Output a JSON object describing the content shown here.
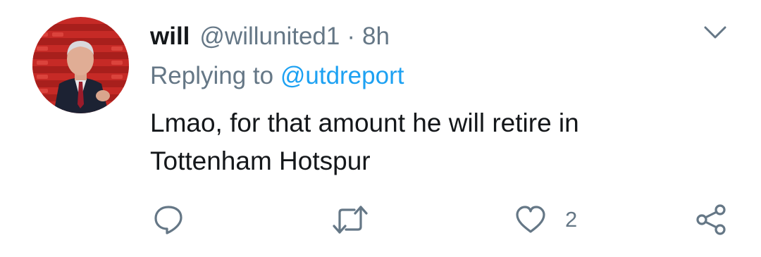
{
  "tweet": {
    "display_name": "will",
    "handle": "@willunited1",
    "separator": "·",
    "time": "8h",
    "replying_prefix": "Replying to",
    "replying_to": "@utdreport",
    "text_line1": "Lmao, for that amount he will retire in",
    "text_line2": "Tottenham Hotspur"
  },
  "actions": {
    "reply_icon": "comment-bubble-icon",
    "retweet_icon": "retweet-arrows-icon",
    "like_icon": "heart-outline-icon",
    "like_count": "2",
    "share_icon": "share-nodes-icon"
  },
  "menu": {
    "caret_icon": "chevron-down-icon"
  },
  "colors": {
    "text_primary": "#14171a",
    "text_secondary": "#657786",
    "link": "#1da1f2",
    "icon": "#657786"
  }
}
